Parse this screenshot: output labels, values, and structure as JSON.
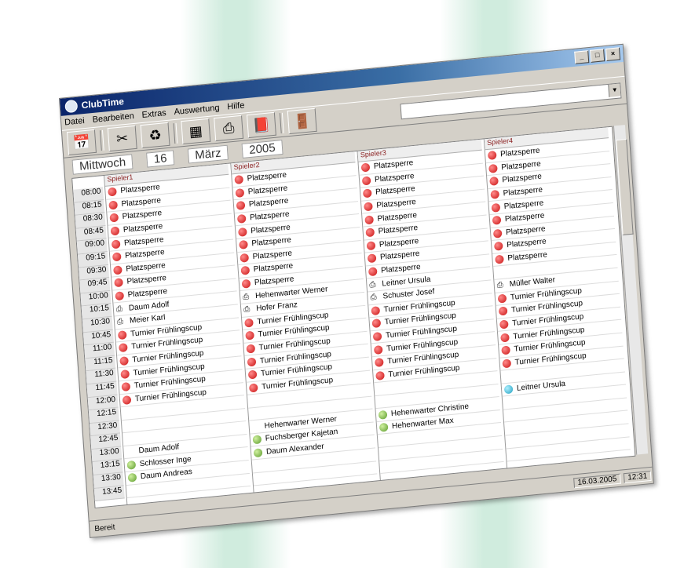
{
  "window": {
    "title": "ClubTime"
  },
  "menu": [
    "Datei",
    "Bearbeiten",
    "Extras",
    "Auswertung",
    "Hilfe"
  ],
  "toolbar_icons": [
    "calendar-icon",
    "scissors-icon",
    "recycle-icon",
    "planner-icon",
    "printer-icon",
    "book-icon",
    "exit-door-icon"
  ],
  "date": {
    "weekday": "Mittwoch",
    "day": "16",
    "month": "März",
    "year": "2005"
  },
  "times": [
    "08:00",
    "08:15",
    "08:30",
    "08:45",
    "09:00",
    "09:15",
    "09:30",
    "09:45",
    "10:00",
    "10:15",
    "10:30",
    "10:45",
    "11:00",
    "11:15",
    "11:30",
    "11:45",
    "12:00",
    "12:15",
    "12:30",
    "12:45",
    "13:00",
    "13:15",
    "13:30",
    "13:45"
  ],
  "courts": [
    {
      "name": "Spieler1",
      "slots": [
        {
          "t": "Platzsperre",
          "i": "red"
        },
        {
          "t": "Platzsperre",
          "i": "red"
        },
        {
          "t": "Platzsperre",
          "i": "red"
        },
        {
          "t": "Platzsperre",
          "i": "red"
        },
        {
          "t": "Platzsperre",
          "i": "red"
        },
        {
          "t": "Platzsperre",
          "i": "red"
        },
        {
          "t": "Platzsperre",
          "i": "red"
        },
        {
          "t": "Platzsperre",
          "i": "red"
        },
        {
          "t": "Platzsperre",
          "i": "red"
        },
        {
          "t": "Daum Adolf",
          "i": "printer"
        },
        {
          "t": "Meier Karl",
          "i": "printer"
        },
        {
          "t": "Turnier Frühlingscup",
          "i": "red"
        },
        {
          "t": "Turnier Frühlingscup",
          "i": "red"
        },
        {
          "t": "Turnier Frühlingscup",
          "i": "red"
        },
        {
          "t": "Turnier Frühlingscup",
          "i": "red"
        },
        {
          "t": "Turnier Frühlingscup",
          "i": "red"
        },
        {
          "t": "Turnier Frühlingscup",
          "i": "red"
        },
        {
          "t": "",
          "i": "blank"
        },
        {
          "t": "",
          "i": "blank"
        },
        {
          "t": "",
          "i": "blank"
        },
        {
          "t": "Daum Adolf",
          "i": "blank"
        },
        {
          "t": "Schlosser Inge",
          "i": "green"
        },
        {
          "t": "Daum Andreas",
          "i": "green"
        },
        {
          "t": "",
          "i": "blank"
        }
      ]
    },
    {
      "name": "Spieler2",
      "slots": [
        {
          "t": "Platzsperre",
          "i": "red"
        },
        {
          "t": "Platzsperre",
          "i": "red"
        },
        {
          "t": "Platzsperre",
          "i": "red"
        },
        {
          "t": "Platzsperre",
          "i": "red"
        },
        {
          "t": "Platzsperre",
          "i": "red"
        },
        {
          "t": "Platzsperre",
          "i": "red"
        },
        {
          "t": "Platzsperre",
          "i": "red"
        },
        {
          "t": "Platzsperre",
          "i": "red"
        },
        {
          "t": "Platzsperre",
          "i": "red"
        },
        {
          "t": "Hehenwarter Werner",
          "i": "printer"
        },
        {
          "t": "Hofer Franz",
          "i": "printer"
        },
        {
          "t": "Turnier Frühlingscup",
          "i": "red"
        },
        {
          "t": "Turnier Frühlingscup",
          "i": "red"
        },
        {
          "t": "Turnier Frühlingscup",
          "i": "red"
        },
        {
          "t": "Turnier Frühlingscup",
          "i": "red"
        },
        {
          "t": "Turnier Frühlingscup",
          "i": "red"
        },
        {
          "t": "Turnier Frühlingscup",
          "i": "red"
        },
        {
          "t": "",
          "i": "blank"
        },
        {
          "t": "",
          "i": "blank"
        },
        {
          "t": "Hehenwarter Werner",
          "i": "blank"
        },
        {
          "t": "Fuchsberger Kajetan",
          "i": "green"
        },
        {
          "t": "Daum Alexander",
          "i": "green"
        },
        {
          "t": "",
          "i": "blank"
        },
        {
          "t": "",
          "i": "blank"
        }
      ]
    },
    {
      "name": "Spieler3",
      "slots": [
        {
          "t": "Platzsperre",
          "i": "red"
        },
        {
          "t": "Platzsperre",
          "i": "red"
        },
        {
          "t": "Platzsperre",
          "i": "red"
        },
        {
          "t": "Platzsperre",
          "i": "red"
        },
        {
          "t": "Platzsperre",
          "i": "red"
        },
        {
          "t": "Platzsperre",
          "i": "red"
        },
        {
          "t": "Platzsperre",
          "i": "red"
        },
        {
          "t": "Platzsperre",
          "i": "red"
        },
        {
          "t": "Platzsperre",
          "i": "red"
        },
        {
          "t": "Leitner Ursula",
          "i": "printer"
        },
        {
          "t": "Schuster Josef",
          "i": "printer"
        },
        {
          "t": "Turnier Frühlingscup",
          "i": "red"
        },
        {
          "t": "Turnier Frühlingscup",
          "i": "red"
        },
        {
          "t": "Turnier Frühlingscup",
          "i": "red"
        },
        {
          "t": "Turnier Frühlingscup",
          "i": "red"
        },
        {
          "t": "Turnier Frühlingscup",
          "i": "red"
        },
        {
          "t": "Turnier Frühlingscup",
          "i": "red"
        },
        {
          "t": "",
          "i": "blank"
        },
        {
          "t": "",
          "i": "blank"
        },
        {
          "t": "Hehenwarter Christine",
          "i": "green"
        },
        {
          "t": "Hehenwarter Max",
          "i": "green"
        },
        {
          "t": "",
          "i": "blank"
        },
        {
          "t": "",
          "i": "blank"
        },
        {
          "t": "",
          "i": "blank"
        }
      ]
    },
    {
      "name": "Spieler4",
      "slots": [
        {
          "t": "Platzsperre",
          "i": "red"
        },
        {
          "t": "Platzsperre",
          "i": "red"
        },
        {
          "t": "Platzsperre",
          "i": "red"
        },
        {
          "t": "Platzsperre",
          "i": "red"
        },
        {
          "t": "Platzsperre",
          "i": "red"
        },
        {
          "t": "Platzsperre",
          "i": "red"
        },
        {
          "t": "Platzsperre",
          "i": "red"
        },
        {
          "t": "Platzsperre",
          "i": "red"
        },
        {
          "t": "Platzsperre",
          "i": "red"
        },
        {
          "t": "",
          "i": "blank"
        },
        {
          "t": "Müller Walter",
          "i": "printer"
        },
        {
          "t": "Turnier Frühlingscup",
          "i": "red"
        },
        {
          "t": "Turnier Frühlingscup",
          "i": "red"
        },
        {
          "t": "Turnier Frühlingscup",
          "i": "red"
        },
        {
          "t": "Turnier Frühlingscup",
          "i": "red"
        },
        {
          "t": "Turnier Frühlingscup",
          "i": "red"
        },
        {
          "t": "Turnier Frühlingscup",
          "i": "red"
        },
        {
          "t": "",
          "i": "blank"
        },
        {
          "t": "Leitner Ursula",
          "i": "cyan"
        },
        {
          "t": "",
          "i": "blank"
        },
        {
          "t": "",
          "i": "blank"
        },
        {
          "t": "",
          "i": "blank"
        },
        {
          "t": "",
          "i": "blank"
        },
        {
          "t": "",
          "i": "blank"
        }
      ]
    }
  ],
  "status": {
    "left": "Bereit",
    "date": "16.03.2005",
    "time": "12:31"
  }
}
